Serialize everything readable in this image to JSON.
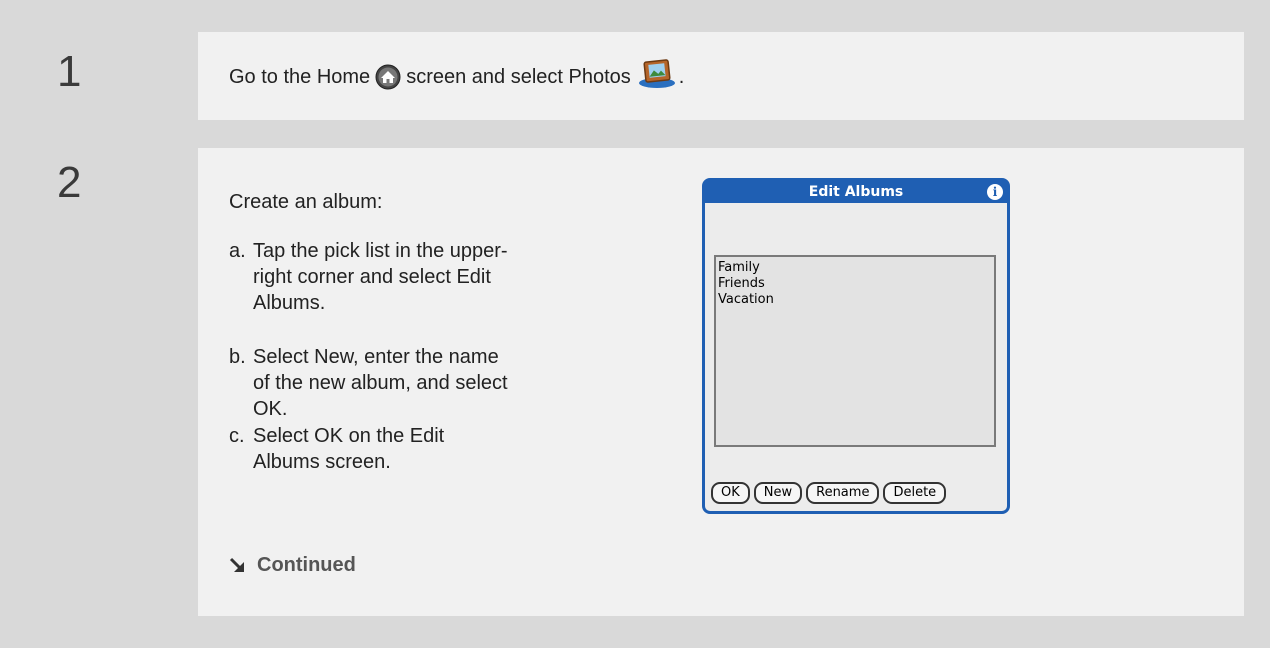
{
  "step1": {
    "number": "1",
    "text_before_home": "Go to the Home",
    "text_after_home": "screen and select Photos",
    "text_end": ".",
    "icons": [
      "home-icon",
      "photos-icon"
    ]
  },
  "step2": {
    "number": "2",
    "intro": "Create an album:",
    "substeps": [
      {
        "letter": "a.",
        "text": "Tap the pick list in the upper-right corner and select Edit Albums."
      },
      {
        "letter": "b.",
        "text": "Select New, enter the name of the new album, and select OK."
      },
      {
        "letter": "c.",
        "text": "Select OK on the Edit Albums screen."
      }
    ],
    "continued": "Continued"
  },
  "dialog": {
    "title": "Edit Albums",
    "info_icon": "i",
    "albums": [
      "Family",
      "Friends",
      "Vacation"
    ],
    "buttons": [
      "OK",
      "New",
      "Rename",
      "Delete"
    ]
  }
}
